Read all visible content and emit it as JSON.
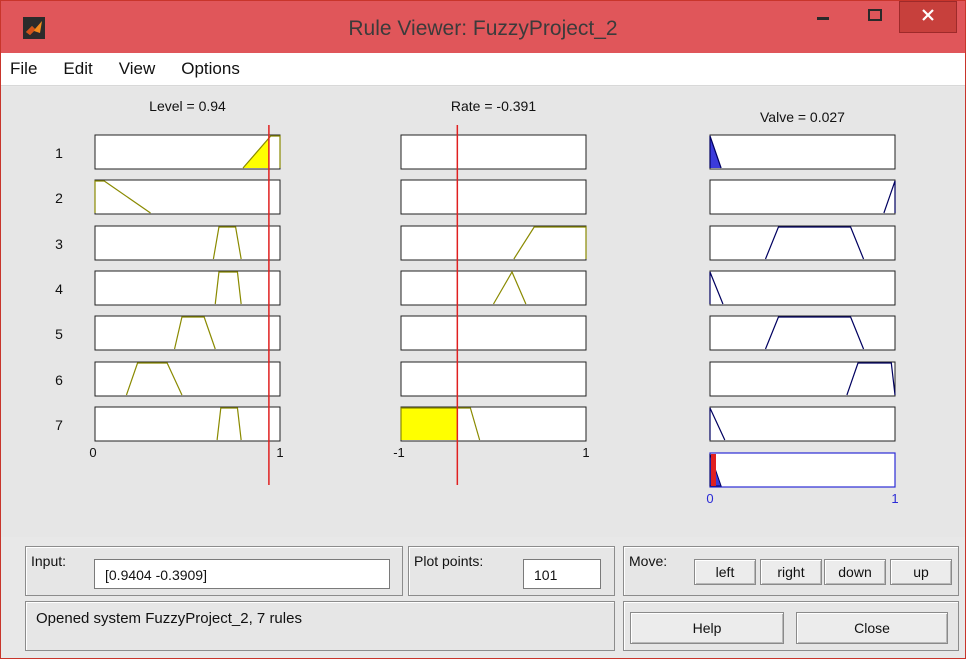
{
  "window": {
    "title": "Rule Viewer: FuzzyProject_2",
    "minimize_icon": "minimize-icon",
    "maximize_icon": "maximize-icon",
    "close_icon": "close-icon",
    "app_icon": "matlab-icon"
  },
  "menu": [
    "File",
    "Edit",
    "View",
    "Options"
  ],
  "colors": {
    "input_fill": "#ffff00",
    "input_line": "#8a8a00",
    "output_fill": "#3b3bdb",
    "output_line": "#000060",
    "indicator": "#e02020",
    "aggregate_border": "#2b2bd6"
  },
  "viewer": {
    "rule_numbers": [
      "1",
      "2",
      "3",
      "4",
      "5",
      "6",
      "7"
    ],
    "columns": [
      {
        "header": "Level = 0.94",
        "range": [
          0,
          1
        ],
        "tick_labels": [
          "0",
          "1"
        ],
        "value": 0.94,
        "kind": "input",
        "rules": [
          {
            "mf": [
              0.8,
              0.95,
              1.0,
              1.0
            ],
            "shaded": true
          },
          {
            "mf": [
              0.0,
              0.0,
              0.05,
              0.3
            ],
            "shaded": false
          },
          {
            "mf": [
              0.64,
              0.67,
              0.76,
              0.79
            ],
            "shaded": false
          },
          {
            "mf": [
              0.65,
              0.67,
              0.77,
              0.79
            ],
            "shaded": false
          },
          {
            "mf": [
              0.43,
              0.47,
              0.59,
              0.65
            ],
            "shaded": false
          },
          {
            "mf": [
              0.17,
              0.23,
              0.39,
              0.47
            ],
            "shaded": false
          },
          {
            "mf": [
              0.66,
              0.68,
              0.77,
              0.79
            ],
            "shaded": false
          }
        ]
      },
      {
        "header": "Rate = -0.391",
        "range": [
          -1,
          1
        ],
        "tick_labels": [
          "-1",
          "1"
        ],
        "value": -0.391,
        "kind": "input",
        "rules": [
          {
            "mf": null,
            "shaded": false
          },
          {
            "mf": null,
            "shaded": false
          },
          {
            "mf": [
              0.22,
              0.44,
              1.0,
              1.0
            ],
            "shaded": false
          },
          {
            "mf": [
              0.0,
              0.2,
              0.2,
              0.35
            ],
            "shaded": false
          },
          {
            "mf": null,
            "shaded": false
          },
          {
            "mf": null,
            "shaded": false
          },
          {
            "mf": [
              -1.0,
              -1.0,
              -0.25,
              -0.15
            ],
            "shaded": true
          }
        ]
      },
      {
        "header": "Valve = 0.027",
        "range": [
          0,
          1
        ],
        "tick_labels": [
          "0",
          "1"
        ],
        "value": 0.027,
        "kind": "output",
        "rules": [
          {
            "mf": [
              0.0,
              0.0,
              0.0,
              0.06
            ],
            "shaded": true
          },
          {
            "mf": [
              0.94,
              1.0,
              1.0,
              1.0
            ],
            "shaded": false
          },
          {
            "mf": [
              0.3,
              0.37,
              0.76,
              0.83
            ],
            "shaded": false
          },
          {
            "mf": [
              0.0,
              0.0,
              0.0,
              0.07
            ],
            "shaded": false
          },
          {
            "mf": [
              0.3,
              0.37,
              0.76,
              0.83
            ],
            "shaded": false
          },
          {
            "mf": [
              0.74,
              0.8,
              0.98,
              1.0
            ],
            "shaded": false
          },
          {
            "mf": [
              0.0,
              0.0,
              0.0,
              0.08
            ],
            "shaded": false
          }
        ],
        "aggregate_mf": [
          0.0,
          0.0,
          0.0,
          0.06
        ]
      }
    ]
  },
  "controls": {
    "input_label": "Input:",
    "input_value": "[0.9404 -0.3909]",
    "plot_points_label": "Plot points:",
    "plot_points_value": "101",
    "move_label": "Move:",
    "move_buttons": [
      "left",
      "right",
      "down",
      "up"
    ],
    "status": "Opened system FuzzyProject_2, 7 rules",
    "help_label": "Help",
    "close_label": "Close"
  }
}
